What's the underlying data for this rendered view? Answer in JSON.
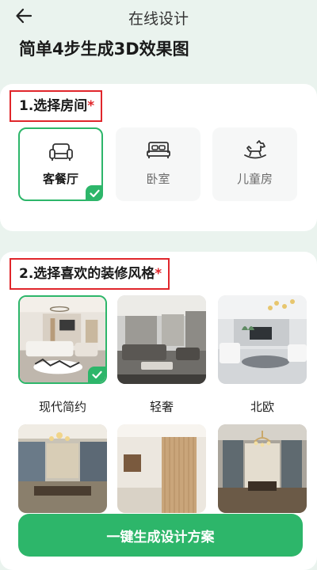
{
  "nav": {
    "title": "在线设计",
    "back_icon": "arrow-left-icon"
  },
  "heading": "简单4步生成3D效果图",
  "room_section": {
    "title": "1.选择房间",
    "required_mark": "*",
    "rooms": [
      {
        "label": "客餐厅",
        "icon": "sofa-icon",
        "selected": true
      },
      {
        "label": "卧室",
        "icon": "bed-icon",
        "selected": false
      },
      {
        "label": "儿童房",
        "icon": "rocking-horse-icon",
        "selected": false
      }
    ]
  },
  "style_section": {
    "title": "2.选择喜欢的装修风格",
    "required_mark": "*",
    "styles": [
      {
        "label": "现代简约",
        "selected": true
      },
      {
        "label": "轻奢",
        "selected": false
      },
      {
        "label": "北欧",
        "selected": false
      },
      {
        "label": "",
        "selected": false
      },
      {
        "label": "",
        "selected": false
      },
      {
        "label": "",
        "selected": false
      }
    ]
  },
  "cta": {
    "label": "一键生成设计方案"
  },
  "colors": {
    "accent": "#2db66a",
    "required": "#e0262b",
    "background": "#eaf3ee"
  }
}
